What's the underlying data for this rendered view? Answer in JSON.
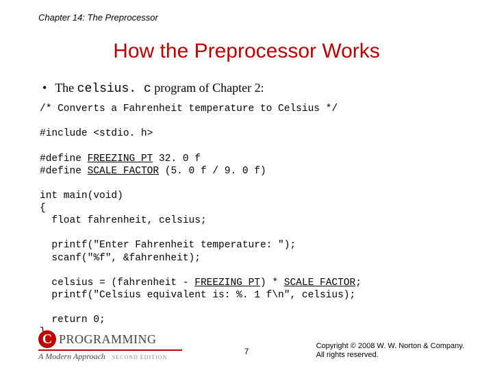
{
  "chapter": "Chapter 14: The Preprocessor",
  "title": "How the Preprocessor Works",
  "bullet": {
    "pre": "The ",
    "code": "celsius. c",
    "post": " program of Chapter 2:"
  },
  "code": {
    "l01": "/* Converts a Fahrenheit temperature to Celsius */",
    "l02": "",
    "l03": "#include <stdio. h>",
    "l04": "",
    "l05a": "#define ",
    "l05b": "FREEZING_PT",
    "l05c": " 32. 0 f",
    "l06a": "#define ",
    "l06b": "SCALE_FACTOR",
    "l06c": " (5. 0 f / 9. 0 f)",
    "l07": "",
    "l08": "int main(void)",
    "l09": "{",
    "l10": "  float fahrenheit, celsius;",
    "l11": "",
    "l12": "  printf(\"Enter Fahrenheit temperature: \");",
    "l13": "  scanf(\"%f\", &fahrenheit);",
    "l14": "",
    "l15a": "  celsius = (fahrenheit - ",
    "l15b": "FREEZING_PT",
    "l15c": ") * ",
    "l15d": "SCALE_FACTOR",
    "l15e": ";",
    "l16": "  printf(\"Celsius equivalent is: %. 1 f\\n\", celsius);",
    "l17": "",
    "l18": "  return 0;",
    "l19": "}"
  },
  "page_number": "7",
  "copyright": {
    "line1": "Copyright © 2008 W. W. Norton & Company.",
    "line2": "All rights reserved."
  },
  "logo": {
    "c": "C",
    "word": "PROGRAMMING",
    "sub_left": "A Modern Approach",
    "sub_right": "SECOND EDITION"
  }
}
